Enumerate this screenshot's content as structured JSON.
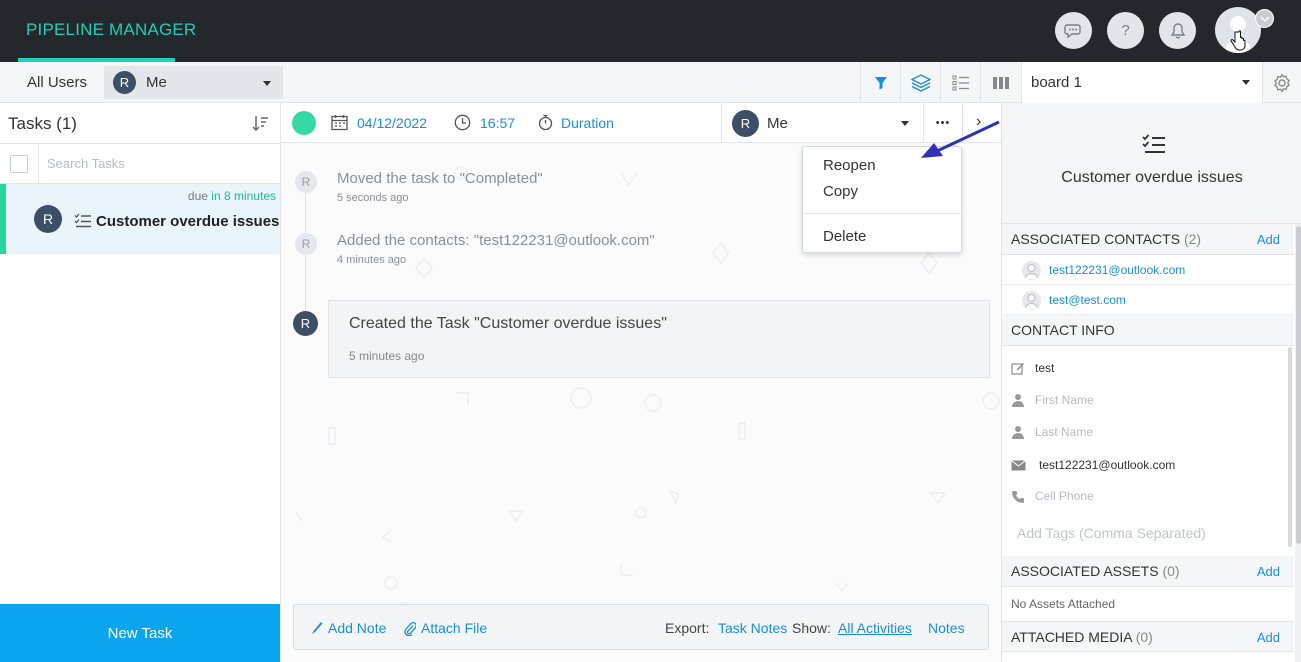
{
  "app": {
    "title": "PIPELINE MANAGER"
  },
  "colors": {
    "accent": "#1fd1b5",
    "link": "#1a8fd6",
    "primary_button": "#0aa4ef",
    "status_done": "#34d9a5",
    "avatar": "#3d4f66",
    "topbar": "#24272b"
  },
  "header_icons": [
    "chat-icon",
    "help-icon",
    "bell-icon",
    "user-avatar"
  ],
  "subbar": {
    "all_users": "All Users",
    "user_initial": "R",
    "user_name": "Me",
    "board": "board 1",
    "tools": [
      "filter-icon",
      "layers-icon",
      "list-view-icon",
      "board-view-icon",
      "settings-icon"
    ]
  },
  "tasks": {
    "title": "Tasks (1)",
    "search_placeholder": "Search Tasks",
    "items": [
      {
        "initial": "R",
        "due_prefix": "due",
        "due_value": "in 8 minutes",
        "name": "Customer overdue issues"
      }
    ],
    "new_task": "New Task"
  },
  "task_header": {
    "date": "04/12/2022",
    "time": "16:57",
    "duration": "Duration",
    "assignee_initial": "R",
    "assignee": "Me",
    "more": "•••",
    "next": "›"
  },
  "activities": [
    {
      "initial": "R",
      "text": "Moved the task to \"Completed\"",
      "time": "5 seconds ago"
    },
    {
      "initial": "R",
      "text": "Added the contacts: \"test122231@outlook.com\"",
      "time": "4 minutes ago"
    },
    {
      "initial": "R",
      "text": "Created the Task \"Customer overdue issues\"",
      "time": "5 minutes ago"
    }
  ],
  "footer": {
    "add_note": "Add Note",
    "attach_file": "Attach File",
    "export_label": "Export:",
    "task_notes": "Task Notes",
    "show_label": "Show:",
    "all_activities": "All Activities",
    "notes": "Notes"
  },
  "context_menu": {
    "items": [
      "Reopen",
      "Copy",
      "Delete"
    ]
  },
  "detail": {
    "title": "Customer overdue issues",
    "associated_contacts": {
      "label": "ASSOCIATED CONTACTS",
      "count": "(2)",
      "add": "Add"
    },
    "contacts": [
      "test122231@outlook.com",
      "test@test.com"
    ],
    "contact_info": {
      "label": "CONTACT INFO",
      "name": "test",
      "first_name_placeholder": "First Name",
      "last_name_placeholder": "Last Name",
      "email": "test122231@outlook.com",
      "cell_phone_placeholder": "Cell Phone",
      "tags_placeholder": "Add Tags (Comma Separated)"
    },
    "associated_assets": {
      "label": "ASSOCIATED ASSETS",
      "count": "(0)",
      "add": "Add",
      "empty": "No Assets Attached"
    },
    "attached_media": {
      "label": "ATTACHED MEDIA",
      "count": "(0)",
      "add": "Add"
    }
  }
}
